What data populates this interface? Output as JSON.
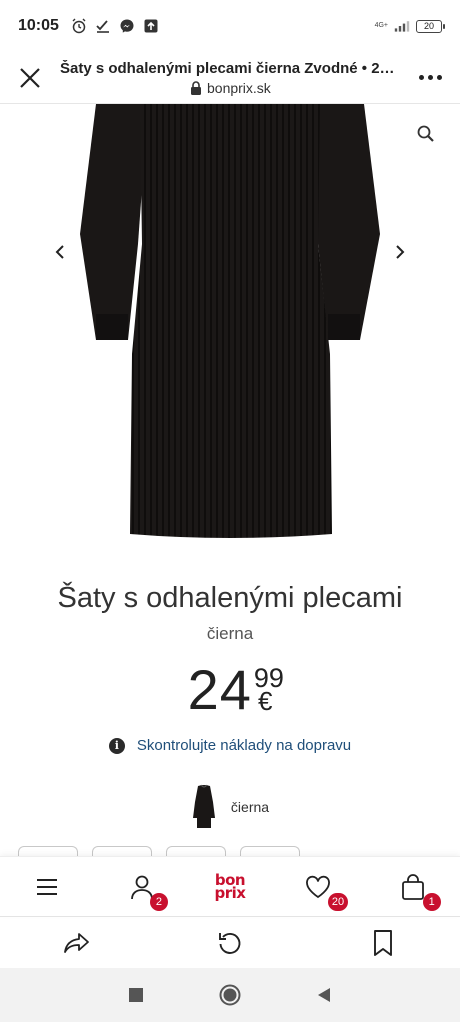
{
  "status_bar": {
    "time": "10:05",
    "network": "4G+",
    "battery": "20",
    "icons": [
      "alarm-icon",
      "check-icon",
      "messenger-icon",
      "upload-icon",
      "signal-icon"
    ]
  },
  "browser": {
    "page_title": "Šaty s odhalenými plecami čierna Zvodné • 24....",
    "domain": "bonprix.sk"
  },
  "product": {
    "title": "Šaty s odhalenými plecami",
    "color": "čierna",
    "price_main": "24",
    "price_cents": "99",
    "currency": "€",
    "shipping_link": "Skontrolujte náklady na dopravu",
    "info_icon": "i",
    "variant_label": "čierna",
    "dress_color": "#1a1716"
  },
  "site_nav": {
    "account_badge": "2",
    "wishlist_badge": "20",
    "cart_badge": "1",
    "logo_top": "bon",
    "logo_bottom": "prix",
    "brand_color": "#c8102e"
  },
  "colors": {
    "link": "#1f4e79",
    "badge": "#c8102e"
  }
}
